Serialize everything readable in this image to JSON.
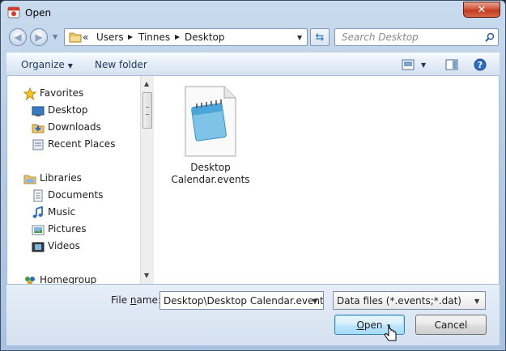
{
  "window": {
    "title": "Open"
  },
  "address": {
    "overflow": "«",
    "crumbs": [
      "Users",
      "Tinnes",
      "Desktop"
    ]
  },
  "search": {
    "placeholder": "Search Desktop"
  },
  "toolbar": {
    "organize": "Organize",
    "new_folder": "New folder"
  },
  "nav": {
    "favorites": {
      "label": "Favorites",
      "items": [
        "Desktop",
        "Downloads",
        "Recent Places"
      ]
    },
    "libraries": {
      "label": "Libraries",
      "items": [
        "Documents",
        "Music",
        "Pictures",
        "Videos"
      ]
    },
    "homegroup": "Homegroup"
  },
  "files": [
    {
      "name_line1": "Desktop",
      "name_line2": "Calendar.events",
      "icon": "notepad-file-icon"
    }
  ],
  "bottom": {
    "file_name_label_pre": "File ",
    "file_name_label_key": "n",
    "file_name_label_post": "ame:",
    "file_name_value": "Desktop\\Desktop Calendar.events",
    "file_type_value": "Data files (*.events;*.dat)",
    "open_key": "O",
    "open_rest": "pen",
    "cancel_label": "Cancel"
  },
  "colors": {
    "accent": "#3c7fb1",
    "close": "#c13b1f",
    "frame": "#b7cde6"
  }
}
